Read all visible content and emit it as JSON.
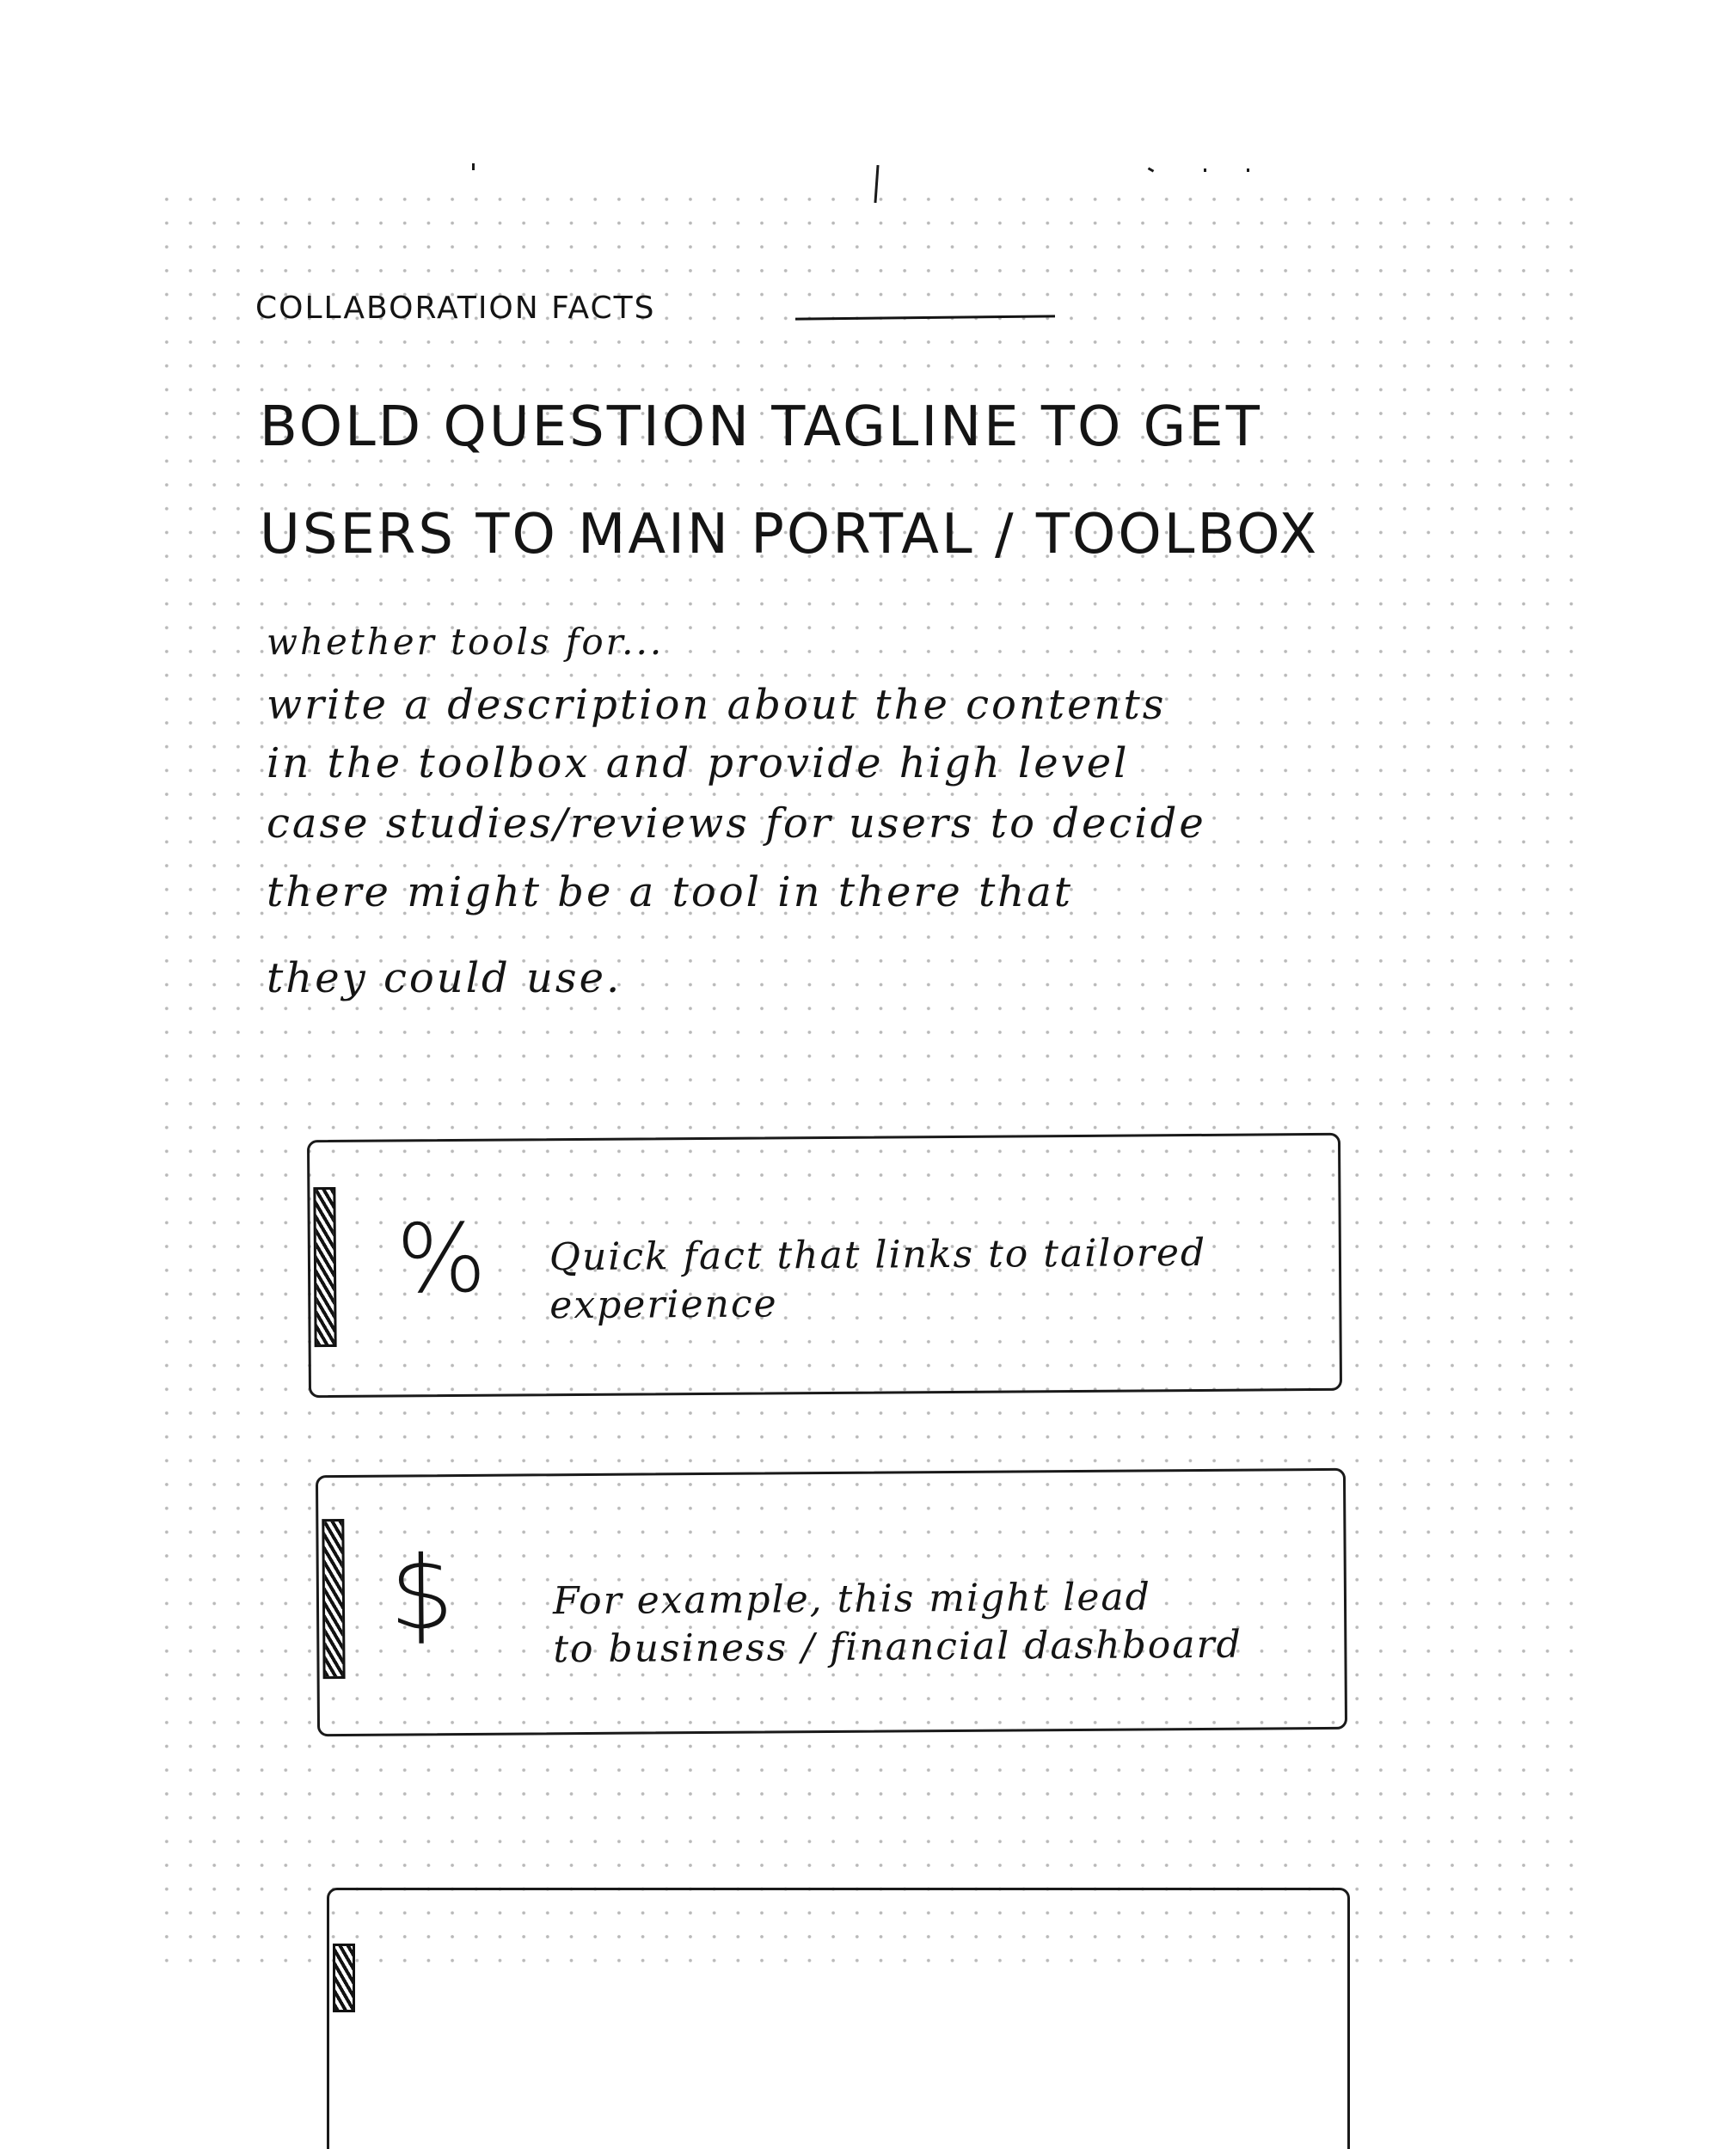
{
  "header": {
    "eyebrow": "COLLABORATION FACTS"
  },
  "hero": {
    "tagline_line1": "BOLD QUESTION TAGLINE TO GET",
    "tagline_line2": "USERS TO MAIN PORTAL / TOOLBOX",
    "description_lines": [
      "whether tools for...",
      "write a description about the contents",
      "in the toolbox and provide high level",
      "case studies/reviews for users to decide",
      "there might be a tool in there that",
      "they could use."
    ]
  },
  "cards": [
    {
      "icon": "percent-icon",
      "icon_glyph": "%",
      "text_line1": "Quick fact that links to tailored",
      "text_line2": "experience"
    },
    {
      "icon": "dollar-icon",
      "icon_glyph": "$",
      "text_line1": "For example, this might lead",
      "text_line2": "to business / financial dashboard"
    },
    {
      "icon": "",
      "text_line1": "",
      "text_line2": ""
    }
  ]
}
